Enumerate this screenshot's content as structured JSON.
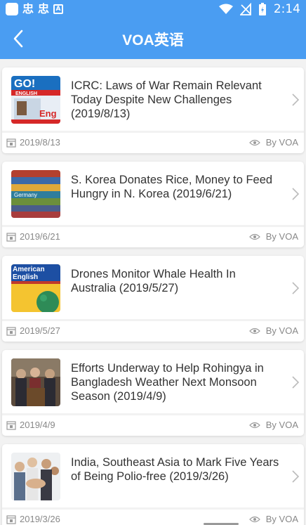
{
  "status_bar": {
    "time": "2:14",
    "left_glyphs": [
      "忠",
      "忠"
    ],
    "a_badge": "A"
  },
  "app_bar": {
    "title": "VOA英语"
  },
  "articles": [
    {
      "title": "ICRC: Laws of War Remain Relevant Today Despite New Challenges (2019/8/13)",
      "date": "2019/8/13",
      "author": "By VOA"
    },
    {
      "title": "S. Korea Donates Rice, Money to Feed Hungry in N. Korea (2019/6/21)",
      "date": "2019/6/21",
      "author": "By VOA"
    },
    {
      "title": "Drones Monitor Whale Health In Australia (2019/5/27)",
      "date": "2019/5/27",
      "author": "By VOA"
    },
    {
      "title": "Efforts Underway to Help Rohingya in Bangladesh Weather Next Monsoon Season (2019/4/9)",
      "date": "2019/4/9",
      "author": "By VOA"
    },
    {
      "title": "India, Southeast Asia to Mark Five Years of Being Polio-free (2019/3/26)",
      "date": "2019/3/26",
      "author": "By VOA"
    }
  ],
  "thumbnails": [
    {
      "kind": "go-english-magazine",
      "text_go": "GO!",
      "text_english": "ENGLISH",
      "text_eng": "Eng"
    },
    {
      "kind": "stacked-language-books",
      "text_germany": "Germany"
    },
    {
      "kind": "american-english-book",
      "text_line1": "American",
      "text_line2": "English"
    },
    {
      "kind": "press-conference-photo"
    },
    {
      "kind": "team-hands-photo"
    }
  ],
  "colors": {
    "primary": "#4a9df2",
    "text": "#333333",
    "meta": "#888888",
    "background": "#f2f2f2"
  }
}
